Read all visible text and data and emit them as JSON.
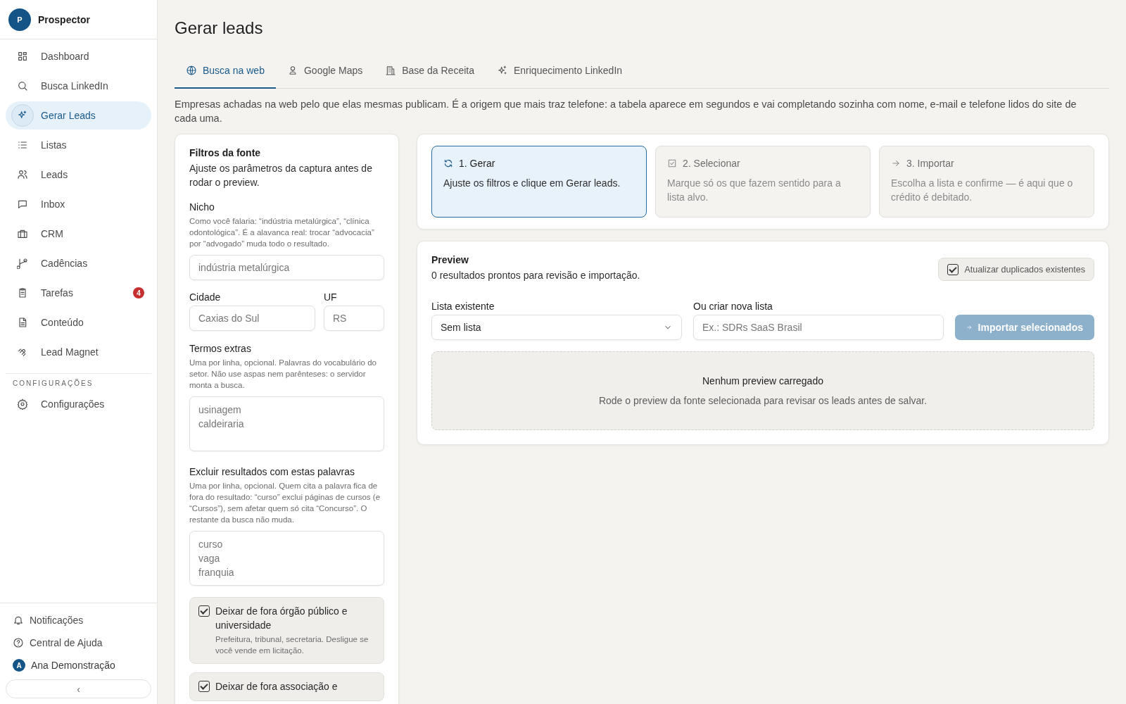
{
  "sidebar": {
    "logo_letter": "P",
    "app_name": "Prospector",
    "items": [
      {
        "label": "Dashboard",
        "selected": false
      },
      {
        "label": "Busca LinkedIn",
        "selected": false
      },
      {
        "label": "Gerar Leads",
        "selected": true
      },
      {
        "label": "Listas",
        "selected": false
      },
      {
        "label": "Leads",
        "selected": false
      },
      {
        "label": "Inbox",
        "selected": false
      },
      {
        "label": "CRM",
        "selected": false
      },
      {
        "label": "Cadências",
        "selected": false
      },
      {
        "label": "Tarefas",
        "selected": false,
        "badge": "4"
      },
      {
        "label": "Conteúdo",
        "selected": false
      },
      {
        "label": "Lead Magnet",
        "selected": false
      }
    ],
    "section_title": "CONFIGURAÇÕES",
    "settings_items": [
      {
        "label": "Configurações",
        "selected": false
      }
    ],
    "footer": {
      "notifications": "Notificações",
      "help": "Central de Ajuda",
      "user_initial": "A",
      "user_name": "Ana Demonstração",
      "collapse": "‹"
    }
  },
  "page": {
    "title": "Gerar leads",
    "tabs": [
      {
        "label": "Busca na web",
        "selected": true
      },
      {
        "label": "Google Maps",
        "selected": false
      },
      {
        "label": "Base da Receita",
        "selected": false
      },
      {
        "label": "Enriquecimento LinkedIn",
        "selected": false
      }
    ],
    "description": "Empresas achadas na web pelo que elas mesmas publicam. É a origem que mais traz telefone: a tabela aparece em segundos e vai completando sozinha com nome, e-mail e telefone lidos do site de cada uma."
  },
  "filters": {
    "title": "Filtros da fonte",
    "subtitle": "Ajuste os parâmetros da captura antes de rodar o preview.",
    "niche": {
      "label": "Nicho",
      "hint": "Como você falaria: “indústria metalúrgica”, “clínica odontológica”. É a alavanca real: trocar “advocacia” por “advogado” muda todo o resultado.",
      "placeholder": "indústria metalúrgica"
    },
    "city": {
      "label": "Cidade",
      "placeholder": "Caxias do Sul"
    },
    "state": {
      "label": "UF",
      "placeholder": "RS"
    },
    "extra_terms": {
      "label": "Termos extras",
      "hint": "Uma por linha, opcional. Palavras do vocabulário do setor. Não use aspas nem parênteses: o servidor monta a busca.",
      "placeholder": "usinagem\ncaldeiraria"
    },
    "exclude_words": {
      "label": "Excluir resultados com estas palavras",
      "hint": "Uma por linha, opcional. Quem cita a palavra fica de fora do resultado: “curso” exclui páginas de cursos (e “Cursos”), sem afetar quem só cita “Concurso”. O restante da busca não muda.",
      "placeholder": "curso\nvaga\nfranquia"
    },
    "options": [
      {
        "label": "Deixar de fora órgão público e universidade",
        "hint": "Prefeitura, tribunal, secretaria. Desligue se você vende em licitação.",
        "checked": true
      },
      {
        "label": "Deixar de fora associação e",
        "checked": true
      }
    ]
  },
  "steps": [
    {
      "title": "1. Gerar",
      "text": "Ajuste os filtros e clique em Gerar leads.",
      "selected": true
    },
    {
      "title": "2. Selecionar",
      "text": "Marque só os que fazem sentido para a lista alvo.",
      "selected": false
    },
    {
      "title": "3. Importar",
      "text": "Escolha a lista e confirme — é aqui que o crédito é debitado.",
      "selected": false
    }
  ],
  "preview": {
    "title": "Preview",
    "subtitle": "0 resultados prontos para revisão e importação.",
    "update_duplicates": {
      "label": "Atualizar duplicados existentes",
      "checked": true
    },
    "existing_list": {
      "label": "Lista existente",
      "value": "Sem lista"
    },
    "new_list": {
      "label": "Ou criar nova lista",
      "placeholder": "Ex.: SDRs SaaS Brasil"
    },
    "import_button": {
      "label": "Importar selecionados",
      "disabled": true
    },
    "empty_title": "Nenhum preview carregado",
    "empty_text": "Rode o preview da fonte selecionada para revisar os leads antes de salvar."
  }
}
